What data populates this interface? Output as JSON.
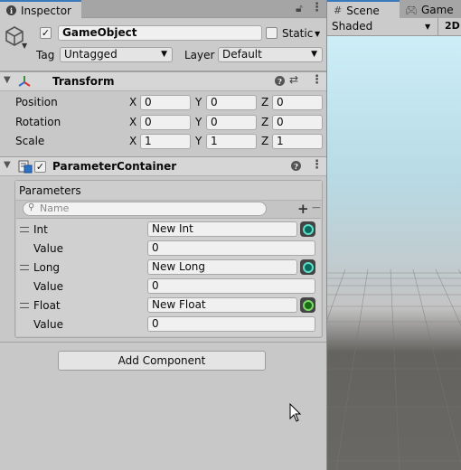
{
  "inspector": {
    "tab_label": "Inspector",
    "object_name": "GameObject",
    "active_checked": true,
    "static_label": "Static",
    "tag_label": "Tag",
    "tag_value": "Untagged",
    "layer_label": "Layer",
    "layer_value": "Default"
  },
  "transform": {
    "title": "Transform",
    "rows": [
      {
        "label": "Position",
        "x": "0",
        "y": "0",
        "z": "0"
      },
      {
        "label": "Rotation",
        "x": "0",
        "y": "0",
        "z": "0"
      },
      {
        "label": "Scale",
        "x": "1",
        "y": "1",
        "z": "1"
      }
    ],
    "axis_x": "X",
    "axis_y": "Y",
    "axis_z": "Z"
  },
  "parameter_container": {
    "title": "ParameterContainer",
    "enabled": true,
    "list_label": "Parameters",
    "search_placeholder": "Name",
    "add_symbol": "+",
    "remove_symbol": "−",
    "value_label": "Value",
    "items": [
      {
        "type": "Int",
        "name": "New Int",
        "value": "0",
        "color": "#0a6a5e"
      },
      {
        "type": "Long",
        "name": "New Long",
        "value": "0",
        "color": "#0a6a5e"
      },
      {
        "type": "Float",
        "name": "New Float",
        "value": "0",
        "color": "#1b6b16"
      }
    ]
  },
  "add_component_label": "Add Component",
  "scene": {
    "tab_scene": "Scene",
    "tab_game": "Game",
    "shading_mode": "Shaded",
    "mode_2d": "2D"
  },
  "icons": {
    "info": "info-icon",
    "lock": "lock-icon",
    "menu": "kebab-menu-icon",
    "help": "help-icon",
    "presets": "presets-icon",
    "cube": "gameobject-cube-icon",
    "transform": "transform-axes-icon",
    "script": "script-icon",
    "search": "search-icon",
    "grid": "scene-grid-icon",
    "gamepad": "gamepad-icon",
    "cursor": "mouse-cursor-icon"
  },
  "colors": {
    "tab_accent": "#3a79bb",
    "panel_bg": "#c8c8c8"
  }
}
